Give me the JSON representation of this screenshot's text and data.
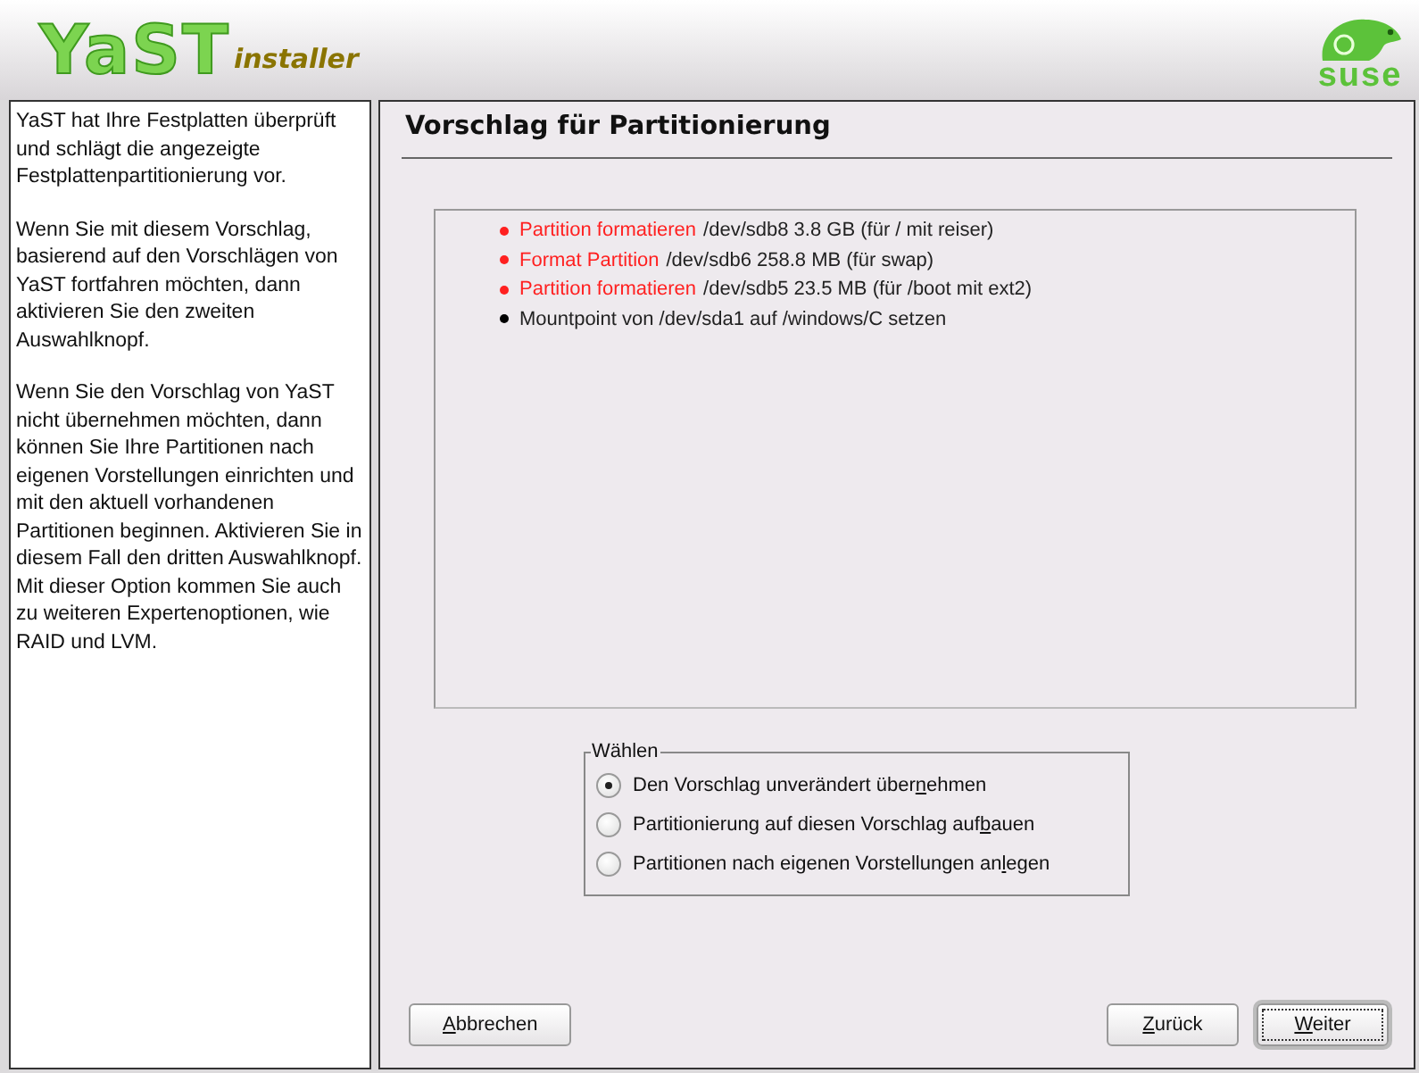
{
  "header": {
    "logo_main": "YaST",
    "logo_sub": "installer",
    "brand": "suse"
  },
  "help": {
    "paragraphs": [
      "YaST hat Ihre Festplatten überprüft und schlägt die angezeigte Festplattenpartitionierung vor.",
      "Wenn Sie mit diesem Vorschlag, basierend auf den Vorschlägen von YaST fortfahren möchten, dann aktivieren Sie den zweiten Auswahlknopf.",
      "Wenn Sie den Vorschlag von YaST nicht übernehmen möchten, dann können Sie Ihre Partitionen nach eigenen Vorstellungen einrichten und mit den aktuell vorhandenen Partitionen beginnen. Aktivieren Sie in diesem Fall den dritten Auswahlknopf. Mit dieser Option kommen Sie auch zu weiteren Expertenoptionen, wie RAID und LVM."
    ]
  },
  "title": "Vorschlag für Partitionierung",
  "proposal": [
    {
      "action": "Partition formatieren",
      "detail": "/dev/sdb8 3.8 GB (für / mit reiser)",
      "color": "#ff2020"
    },
    {
      "action": "Format Partition",
      "detail": "/dev/sdb6 258.8 MB (für swap)",
      "color": "#ff2020"
    },
    {
      "action": "Partition formatieren",
      "detail": "/dev/sdb5 23.5 MB (für /boot mit ext2)",
      "color": "#ff2020"
    },
    {
      "detail": "Mountpoint von /dev/sda1 auf /windows/C setzen",
      "color": "#000000"
    }
  ],
  "choice": {
    "legend": "Wählen",
    "options": [
      {
        "before": "Den Vorschlag unverändert über",
        "key": "n",
        "after": "ehmen",
        "selected": true
      },
      {
        "before": "Partitionierung auf diesen Vorschlag auf",
        "key": "b",
        "after": "auen",
        "selected": false
      },
      {
        "before": "Partitionen nach eigenen Vorstellungen an",
        "key": "l",
        "after": "egen",
        "selected": false
      }
    ]
  },
  "buttons": [
    {
      "key": "A",
      "after": "bbrechen",
      "kind": "abort",
      "default": false
    },
    {
      "key": "Z",
      "after": "urück",
      "kind": "back",
      "default": false
    },
    {
      "key": "W",
      "after": "eiter",
      "kind": "next",
      "default": true
    }
  ]
}
